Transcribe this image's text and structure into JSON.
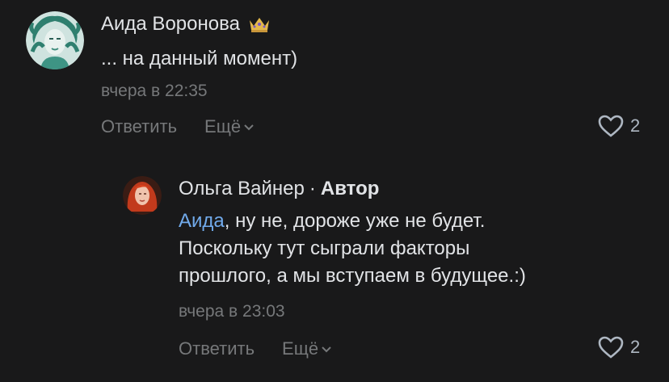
{
  "comment1": {
    "author": "Аида Воронова",
    "badge_icon": "crown-icon",
    "text": "... на данный момент)",
    "time": "вчера в 22:35",
    "reply_label": "Ответить",
    "more_label": "Ещё",
    "likes": "2"
  },
  "comment2": {
    "author": "Ольга Вайнер",
    "separator": "·",
    "author_tag": "Автор",
    "mention": "Аида",
    "text_line1_rest": ", ну не, дороже уже не будет.",
    "text_line2": "Поскольку тут сыграли факторы",
    "text_line3": "прошлого, а мы вступаем в будущее.:)",
    "time": "вчера в 23:03",
    "reply_label": "Ответить",
    "more_label": "Ещё",
    "likes": "2"
  },
  "colors": {
    "background": "#19191a",
    "text_primary": "#e1e3e6",
    "text_secondary": "#76787a",
    "link": "#71aaeb"
  }
}
